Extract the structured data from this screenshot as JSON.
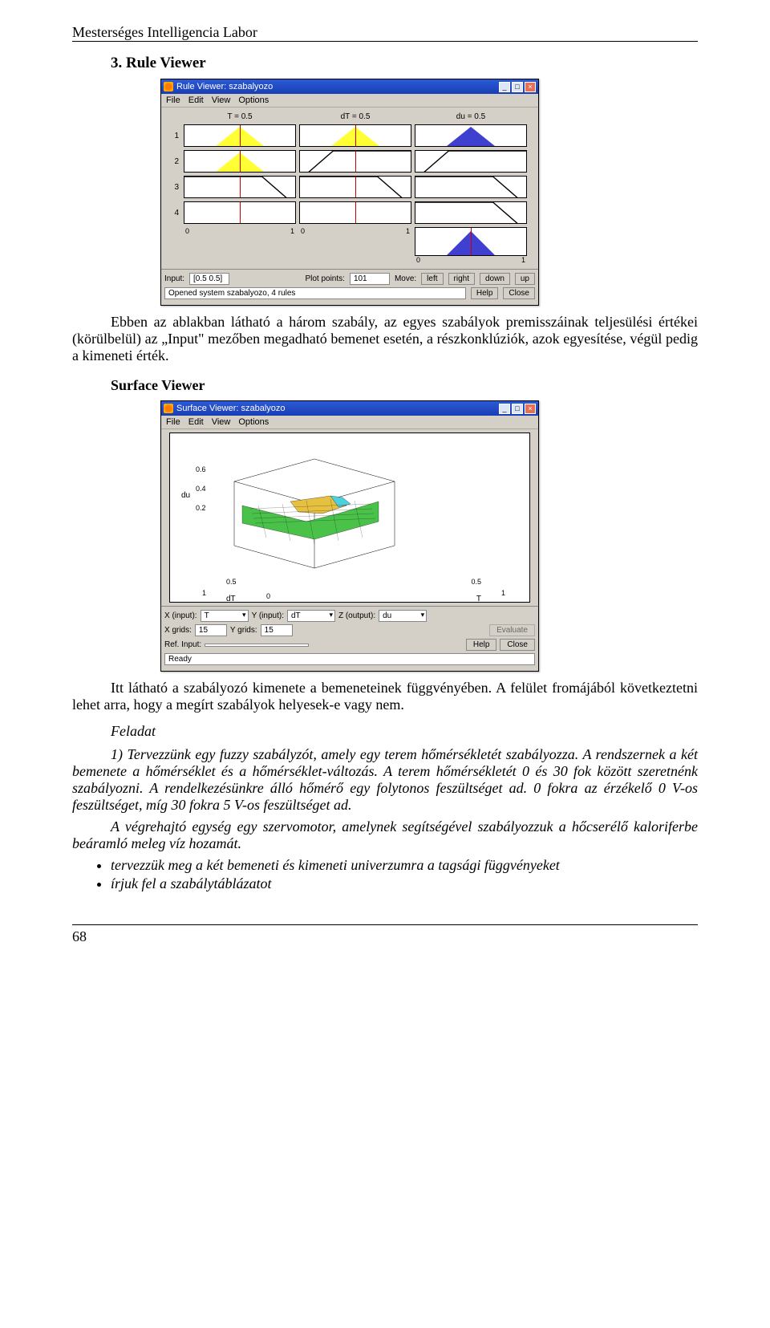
{
  "header": "Mesterséges Intelligencia Labor",
  "section3_title": "3. Rule Viewer",
  "para_rule": "Ebben az ablakban látható a három szabály, az egyes szabályok premisszáinak teljesülési értékei (körülbelül) az „Input\" mezőben megadható bemenet esetén, a részkonklúziók, azok egyesítése, végül pedig a kimeneti érték.",
  "surface_heading": "Surface Viewer",
  "para_surface": "Itt látható a szabályozó kimenete a bemeneteinek függvényében. A felület fromájából következtetni lehet arra, hogy a megírt szabályok helyesek-e vagy nem.",
  "feladat": "Feladat",
  "task_p1": "1) Tervezzünk egy fuzzy szabályzót, amely egy terem hőmérsékletét szabályozza. A rendszernek a két bemenete a hőmérséklet és a hőmérséklet-változás. A terem hőmérsékletét 0 és 30 fok között szeretnénk szabályozni. A rendelkezésünkre álló hőmérő egy folytonos feszültséget ad. 0 fokra az érzékelő 0 V-os feszültséget, míg 30 fokra 5 V-os feszültséget ad.",
  "task_p2": "A végrehajtó egység egy szervomotor, amelynek segítségével szabályozzuk a hőcserélő kaloriferbe beáramló meleg víz hozamát.",
  "bullets": {
    "b1": "tervezzük meg a két bemeneti és kimeneti univerzumra a tagsági függvényeket",
    "b2": "írjuk fel a szabálytáblázatot"
  },
  "page_number": "68",
  "rule_viewer": {
    "title": "Rule Viewer: szabalyozo",
    "menu": {
      "file": "File",
      "edit": "Edit",
      "view": "View",
      "options": "Options"
    },
    "cols": {
      "t": "T = 0.5",
      "dt": "dT = 0.5",
      "du": "du = 0.5"
    },
    "rows": [
      "1",
      "2",
      "3",
      "4"
    ],
    "axis": {
      "lo": "0",
      "hi": "1"
    },
    "input_label": "Input:",
    "input_value": "[0.5 0.5]",
    "plot_label": "Plot points:",
    "plot_value": "101",
    "move_label": "Move:",
    "btn_left": "left",
    "btn_right": "right",
    "btn_down": "down",
    "btn_up": "up",
    "status": "Opened system szabalyozo, 4 rules",
    "btn_help": "Help",
    "btn_close": "Close"
  },
  "surface_viewer": {
    "title": "Surface Viewer: szabalyozo",
    "menu": {
      "file": "File",
      "edit": "Edit",
      "view": "View",
      "options": "Options"
    },
    "zlabel": "du",
    "zticks": [
      "0.6",
      "0.4",
      "0.2"
    ],
    "xylabel_dt": "dT",
    "xylabel_t": "T",
    "xinput_label": "X (input):",
    "xinput_value": "T",
    "yinput_label": "Y (input):",
    "yinput_value": "dT",
    "zoutput_label": "Z (output):",
    "zoutput_value": "du",
    "xgrids_label": "X grids:",
    "xgrids_value": "15",
    "ygrids_label": "Y grids:",
    "ygrids_value": "15",
    "eval_btn": "Evaluate",
    "ref_label": "Ref. Input:",
    "btn_help": "Help",
    "btn_close": "Close",
    "status": "Ready"
  }
}
